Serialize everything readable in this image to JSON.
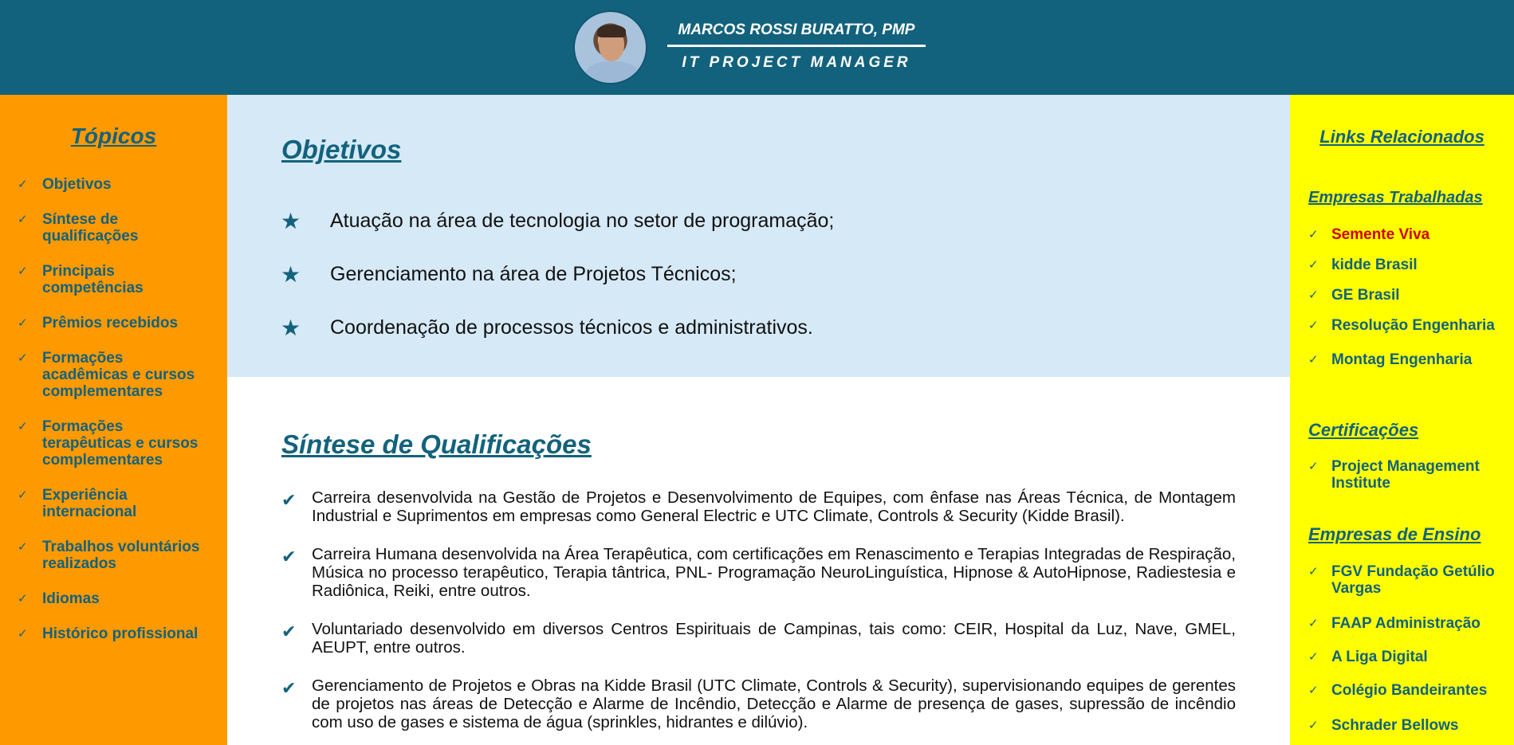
{
  "header": {
    "name": "MARCOS ROSSI BURATTO, PMP",
    "title": "IT PROJECT MANAGER"
  },
  "left_sidebar": {
    "heading": "Tópicos",
    "items": [
      "Objetivos",
      "Síntese de qualificações",
      "Principais competências",
      "Prêmios recebidos",
      "Formações acadêmicas e cursos complementares",
      "Formações terapêuticas e cursos complementares",
      "Experiência internacional",
      "Trabalhos voluntários realizados",
      "Idiomas",
      "Histórico profissional"
    ]
  },
  "objetivos": {
    "heading": "Objetivos",
    "items": [
      "Atuação na área de tecnologia no setor de programação;",
      "Gerenciamento na área de Projetos Técnicos;",
      "Coordenação de processos técnicos e administrativos."
    ]
  },
  "sintese": {
    "heading": "Síntese de Qualificações",
    "items": [
      "Carreira desenvolvida na Gestão de Projetos e Desenvolvimento de Equipes, com ênfase nas Áreas Técnica, de Montagem Industrial e Suprimentos em empresas como General Electric e UTC Climate, Controls & Security (Kidde Brasil).",
      "Carreira Humana desenvolvida na Área Terapêutica, com certificações em Renascimento e Terapias Integradas de Respiração, Música no processo terapêutico, Terapia tântrica, PNL- Programação NeuroLinguística, Hipnose & AutoHipnose, Radiestesia e Radiônica, Reiki, entre outros.",
      "Voluntariado desenvolvido em diversos Centros Espirituais de Campinas, tais como: CEIR, Hospital da Luz, Nave, GMEL, AEUPT, entre outros.",
      "Gerenciamento de Projetos e Obras na Kidde Brasil (UTC Climate, Controls & Security), supervisionando equipes de gerentes de projetos nas áreas de Detecção e Alarme de Incêndio, Detecção e Alarme de presença de gases, supressão de incêndio com uso de gases e sistema de água (sprinkles, hidrantes e dilúvio)."
    ]
  },
  "right_sidebar": {
    "heading": "Links Relacionados",
    "sections": [
      {
        "title": "Empresas Trabalhadas",
        "items": [
          "Semente Viva",
          "kidde Brasil",
          "GE Brasil",
          "Resolução Engenharia",
          "Montag Engenharia"
        ]
      },
      {
        "title": "Certificações",
        "items": [
          "Project Management Institute"
        ]
      },
      {
        "title": "Empresas de Ensino",
        "items": [
          "FGV Fundação Getúlio Vargas",
          "FAAP Administração",
          "A Liga Digital",
          "Colégio Bandeirantes",
          "Schrader Bellows"
        ]
      }
    ]
  },
  "colors": {
    "header_bg": "#13627d",
    "left_bg": "#ff9900",
    "right_bg": "#ffff00",
    "objetivos_bg": "#d6e9f7",
    "accent": "#13627d",
    "active_link": "#cc0000"
  }
}
